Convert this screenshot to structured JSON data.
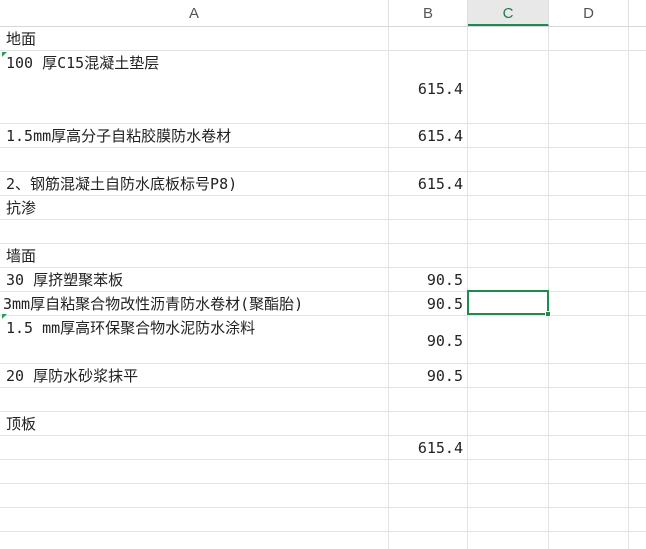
{
  "columns": {
    "a": "A",
    "b": "B",
    "c": "C",
    "d": "D"
  },
  "selected_column": "C",
  "rows": [
    {
      "a": "地面",
      "b": ""
    },
    {
      "a": "100 厚C15混凝土垫层",
      "b": "615.4"
    },
    {
      "a": "1.5mm厚高分子自粘胶膜防水卷材",
      "b": "615.4"
    },
    {
      "a": "",
      "b": ""
    },
    {
      "a": "2、钢筋混凝土自防水底板标号P8)",
      "b": "615.4"
    },
    {
      "a": "抗渗",
      "b": ""
    },
    {
      "a": "",
      "b": ""
    },
    {
      "a": "墙面",
      "b": ""
    },
    {
      "a": "30 厚挤塑聚苯板",
      "b": "90.5"
    },
    {
      "a": "3mm厚自粘聚合物改性沥青防水卷材(聚酯胎)",
      "b": "90.5"
    },
    {
      "a": "1.5 mm厚高环保聚合物水泥防水涂料",
      "b": "90.5"
    },
    {
      "a": "20 厚防水砂浆抹平",
      "b": "90.5"
    },
    {
      "a": "",
      "b": ""
    },
    {
      "a": "顶板",
      "b": ""
    },
    {
      "a": "",
      "b": "615.4"
    },
    {
      "a": "",
      "b": ""
    },
    {
      "a": "",
      "b": ""
    },
    {
      "a": "",
      "b": ""
    }
  ]
}
